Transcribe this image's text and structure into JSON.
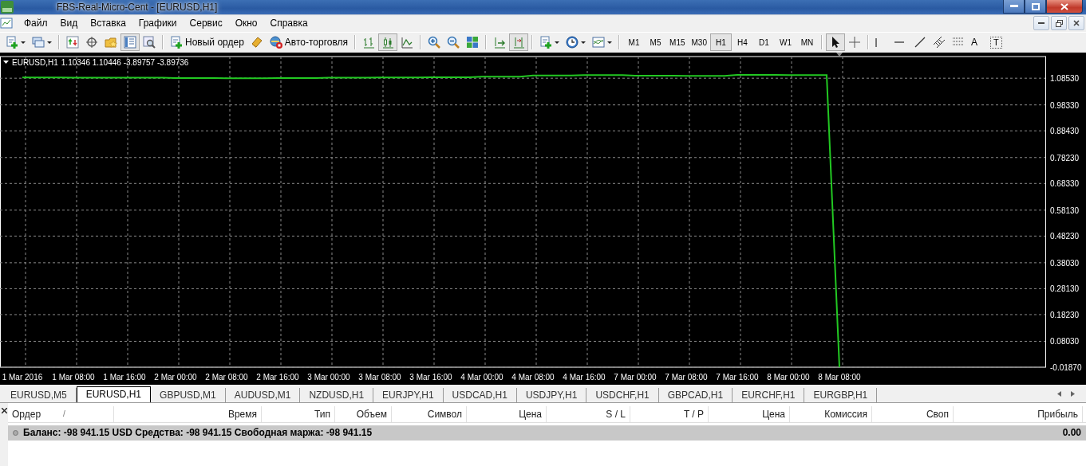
{
  "window": {
    "title": "FBS-Real-Micro-Cent - [EURUSD,H1]"
  },
  "menu": [
    "Файл",
    "Вид",
    "Вставка",
    "Графики",
    "Сервис",
    "Окно",
    "Справка"
  ],
  "toolbar": [
    [
      {
        "kind": "newchart",
        "pressed": false,
        "dropdown": true
      },
      {
        "kind": "profiles",
        "pressed": false,
        "dropdown": true
      }
    ],
    [
      {
        "kind": "marketwatch",
        "pressed": false
      },
      {
        "kind": "datawindow",
        "pressed": false
      },
      {
        "kind": "navigator",
        "pressed": false
      },
      {
        "kind": "terminal",
        "pressed": true
      },
      {
        "kind": "tester",
        "pressed": false
      }
    ],
    [
      {
        "kind": "order",
        "pressed": false,
        "label": "Новый ордер"
      },
      {
        "kind": "metaeditor",
        "pressed": false
      },
      {
        "kind": "autotrade",
        "pressed": false,
        "label": "Авто-торговля"
      }
    ],
    [
      {
        "kind": "bars",
        "pressed": false
      },
      {
        "kind": "candles",
        "pressed": true
      },
      {
        "kind": "line",
        "pressed": false
      }
    ],
    [
      {
        "kind": "zoomin",
        "pressed": false
      },
      {
        "kind": "zoomout",
        "pressed": false
      },
      {
        "kind": "tile",
        "pressed": false
      }
    ],
    [
      {
        "kind": "autoscroll",
        "pressed": false
      },
      {
        "kind": "shift",
        "pressed": true
      }
    ],
    [
      {
        "kind": "indicators",
        "pressed": false,
        "dropdown": true
      },
      {
        "kind": "periods",
        "pressed": false,
        "dropdown": true
      },
      {
        "kind": "templates",
        "pressed": false,
        "dropdown": true
      }
    ],
    [
      {
        "kind": "timeframe",
        "label": "M1",
        "pressed": false
      },
      {
        "kind": "timeframe",
        "label": "M5",
        "pressed": false
      },
      {
        "kind": "timeframe",
        "label": "M15",
        "pressed": false
      },
      {
        "kind": "timeframe",
        "label": "M30",
        "pressed": false
      },
      {
        "kind": "timeframe",
        "label": "H1",
        "pressed": true
      },
      {
        "kind": "timeframe",
        "label": "H4",
        "pressed": false
      },
      {
        "kind": "timeframe",
        "label": "D1",
        "pressed": false
      },
      {
        "kind": "timeframe",
        "label": "W1",
        "pressed": false
      },
      {
        "kind": "timeframe",
        "label": "MN",
        "pressed": false
      }
    ],
    [
      {
        "kind": "cursor",
        "pressed": true
      },
      {
        "kind": "crosshair",
        "pressed": false
      }
    ],
    [
      {
        "kind": "vline",
        "pressed": false
      },
      {
        "kind": "hline",
        "pressed": false
      },
      {
        "kind": "trend",
        "pressed": false
      },
      {
        "kind": "channel",
        "pressed": false
      },
      {
        "kind": "fibo",
        "pressed": false
      },
      {
        "kind": "text",
        "label": "A",
        "pressed": false
      },
      {
        "kind": "textlabel",
        "label": "T",
        "pressed": false
      }
    ]
  ],
  "chart": {
    "symbol": "EURUSD,H1",
    "quotes": "1.10346 1.10446 -3.89757 -3.89736",
    "chart_data": {
      "type": "line",
      "categories": [
        "1 Mar 2016",
        null,
        null,
        null,
        "1 Mar 08:00",
        null,
        null,
        null,
        "1 Mar 16:00",
        null,
        null,
        null,
        "2 Mar 00:00",
        null,
        null,
        null,
        "2 Mar 08:00",
        null,
        null,
        null,
        "2 Mar 16:00",
        null,
        null,
        null,
        "3 Mar 00:00",
        null,
        null,
        null,
        "3 Mar 08:00",
        null,
        null,
        null,
        "3 Mar 16:00",
        null,
        null,
        null,
        "4 Mar 00:00",
        null,
        null,
        null,
        "4 Mar 08:00",
        null,
        null,
        null,
        "4 Mar 16:00",
        null,
        null,
        null,
        "7 Mar 00:00",
        null,
        null,
        null,
        "7 Mar 08:00",
        null,
        null,
        null,
        "7 Mar 16:00",
        null,
        null,
        null,
        "8 Mar 00:00",
        null,
        null,
        null,
        "8 Mar 08:00"
      ],
      "grid": true,
      "series": [
        {
          "color": "#22c822",
          "values": [
            1.088,
            1.088,
            1.088,
            1.088,
            1.087,
            1.087,
            1.087,
            1.087,
            1.087,
            1.087,
            1.087,
            1.087,
            1.086,
            1.086,
            1.086,
            1.086,
            1.085,
            1.085,
            1.085,
            1.085,
            1.086,
            1.086,
            1.086,
            1.086,
            1.087,
            1.087,
            1.087,
            1.087,
            1.088,
            1.088,
            1.088,
            1.088,
            1.089,
            1.089,
            1.089,
            1.089,
            1.091,
            1.091,
            1.091,
            1.091,
            1.096,
            1.096,
            1.096,
            1.096,
            1.097,
            1.097,
            1.097,
            1.097,
            1.095,
            1.095,
            1.095,
            1.095,
            1.094,
            1.094,
            1.094,
            1.094,
            1.098,
            1.098,
            1.098,
            1.098,
            1.097,
            1.097,
            1.097,
            1.097,
            -0.0187
          ]
        }
      ],
      "ylim": [
        -0.0187,
        1.168
      ],
      "yticks": [
        {
          "value": 1.0853,
          "label": "1.08530"
        },
        {
          "value": 0.9833,
          "label": "0.98330"
        },
        {
          "value": 0.8843,
          "label": "0.88430"
        },
        {
          "value": 0.7823,
          "label": "0.78230"
        },
        {
          "value": 0.6833,
          "label": "0.68330"
        },
        {
          "value": 0.5813,
          "label": "0.58130"
        },
        {
          "value": 0.4823,
          "label": "0.48230"
        },
        {
          "value": 0.3803,
          "label": "0.38030"
        },
        {
          "value": 0.2813,
          "label": "0.28130"
        },
        {
          "value": 0.1823,
          "label": "0.18230"
        },
        {
          "value": 0.0803,
          "label": "0.08030"
        },
        {
          "value": -0.0187,
          "label": "-0.01870"
        }
      ]
    }
  },
  "chart_tabs": [
    {
      "label": "EURUSD,M5",
      "selected": false
    },
    {
      "label": "EURUSD,H1",
      "selected": true
    },
    {
      "label": "GBPUSD,M1",
      "selected": false
    },
    {
      "label": "AUDUSD,M1",
      "selected": false
    },
    {
      "label": "NZDUSD,H1",
      "selected": false
    },
    {
      "label": "EURJPY,H1",
      "selected": false
    },
    {
      "label": "USDCAD,H1",
      "selected": false
    },
    {
      "label": "USDJPY,H1",
      "selected": false
    },
    {
      "label": "USDCHF,H1",
      "selected": false
    },
    {
      "label": "GBPCAD,H1",
      "selected": false
    },
    {
      "label": "EURCHF,H1",
      "selected": false
    },
    {
      "label": "EURGBP,H1",
      "selected": false
    }
  ],
  "terminal": {
    "columns": [
      "Ордер",
      "Время",
      "Тип",
      "Объем",
      "Символ",
      "Цена",
      "S / L",
      "T / P",
      "Цена",
      "Комиссия",
      "Своп",
      "Прибыль"
    ],
    "sort_indicator": "/",
    "summary": {
      "text": "Баланс: -98 941.15 USD  Средства: -98 941.15  Свободная маржа: -98 941.15",
      "profit": "0.00"
    }
  }
}
